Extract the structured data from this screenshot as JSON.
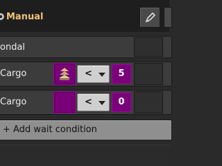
{
  "header": {
    "title": "Manual",
    "gear_icon": "gear-icon",
    "edit_icon": "edit-pencil-icon"
  },
  "conditions": [
    {
      "label": "ondal"
    },
    {
      "label": "Cargo",
      "item_icon": "cargo-wagon-icon",
      "comparator": "<",
      "value": "5"
    },
    {
      "label": "Cargo",
      "comparator": "<",
      "value": "0"
    }
  ],
  "add_button": {
    "label": "+ Add wait condition"
  },
  "colors": {
    "accent_title": "#f2c27a",
    "signal_purple": "#7a007a",
    "panel": "#3c3c3c",
    "button_grey": "#8f8f8f"
  }
}
